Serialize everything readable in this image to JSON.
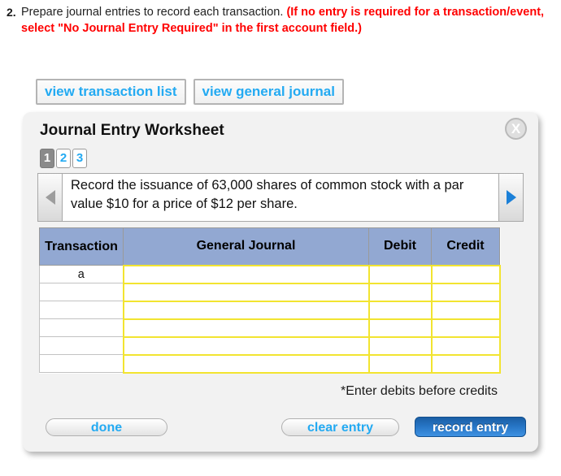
{
  "question": {
    "number": "2.",
    "prompt": "Prepare journal entries to record each transaction.",
    "instruction": "(If no entry is required for a transaction/event, select \"No Journal Entry Required\" in the first account field.)"
  },
  "view_buttons": {
    "transaction_list": "view transaction list",
    "general_journal": "view general journal"
  },
  "panel": {
    "title": "Journal Entry Worksheet",
    "close_icon": "close-icon",
    "close_label": "X",
    "page_tabs": [
      {
        "label": "1",
        "active": true
      },
      {
        "label": "2",
        "active": false
      },
      {
        "label": "3",
        "active": false
      }
    ],
    "nav": {
      "prev_icon": "chevron-left-icon",
      "prev_enabled": false,
      "next_icon": "chevron-right-icon",
      "next_enabled": true,
      "prev_color": "#9d9d9d",
      "next_color": "#1b80d8"
    },
    "description": "Record the issuance of 63,000 shares of common stock with a par value $10 for a price of $12 per share.",
    "table": {
      "headers": [
        "Transaction",
        "General Journal",
        "Debit",
        "Credit"
      ],
      "header_bg": "#92a8d2",
      "input_border": "#f2e430",
      "rows": [
        {
          "transaction": "a",
          "general_journal": "",
          "debit": "",
          "credit": ""
        },
        {
          "transaction": "",
          "general_journal": "",
          "debit": "",
          "credit": ""
        },
        {
          "transaction": "",
          "general_journal": "",
          "debit": "",
          "credit": ""
        },
        {
          "transaction": "",
          "general_journal": "",
          "debit": "",
          "credit": ""
        },
        {
          "transaction": "",
          "general_journal": "",
          "debit": "",
          "credit": ""
        },
        {
          "transaction": "",
          "general_journal": "",
          "debit": "",
          "credit": ""
        }
      ]
    },
    "footnote": "*Enter debits before credits",
    "buttons": {
      "done": "done",
      "clear_entry": "clear entry",
      "record_entry": "record entry"
    }
  }
}
